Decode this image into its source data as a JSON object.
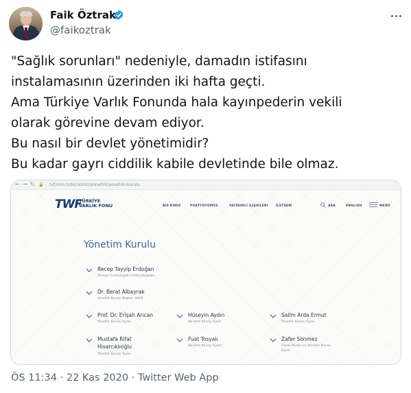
{
  "author": {
    "name": "Faik Öztrak",
    "handle": "@faikoztrak",
    "verified": true
  },
  "tweet": {
    "lines": [
      "\"Sağlık sorunları\" nedeniyle, damadın istifasını",
      "instalamasının üzerinden iki hafta geçti.",
      "Ama Türkiye Varlık Fonunda hala kayınpederin vekili",
      "olarak görevine devam ediyor.",
      "Bu nasıl bir devlet yönetimidir?",
      "Bu kadar gayrı ciddilik kabile devletinde bile olmaz."
    ]
  },
  "attached_screenshot": {
    "url": "tvf.com.tr/biz-kimiz/yonetim/yonetim-kurulu",
    "site": {
      "logo_mark": "TWF",
      "logo_text_line1": "TÜRKİYE",
      "logo_text_line2": "VARLIK FONU",
      "menu": [
        "BİZ KİMİZ",
        "PORTFÖYÜMÜZ",
        "YATIRIMCI İLİŞKİLERİ",
        "İLETİŞİM"
      ],
      "search_label": "ARA",
      "language_label": "ENGLISH",
      "menu_label": "MENÜ",
      "section_title": "Yönetim Kurulu",
      "members": [
        {
          "name": "Recep Tayyip Erdoğan",
          "role": "Türkiye Cumhuriyeti Cumhurbaşkanı"
        },
        {
          "name": "Dr. Berat Albayrak",
          "role": "Yönetim Kurulu Başkan Vekili"
        },
        {
          "name": "Prof. Dr. Erişah Arıcan",
          "role": "Yönetim Kurulu Üyesi"
        },
        {
          "name": "Hüseyin Aydın",
          "role": "Yönetim Kurulu Üyesi"
        },
        {
          "name": "Salim Arda Ermut",
          "role": "Yönetim Kurulu Üyesi"
        },
        {
          "name_line1": "Mustafa Rifat",
          "name_line2": "Hisarcıklıoğlu",
          "role": "Yönetim Kurulu Üyesi"
        },
        {
          "name": "Fuat Tosyalı",
          "role": "Yönetim Kurulu Üyesi"
        },
        {
          "name": "Zafer Sönmez",
          "role_line1": "Genel Müdür ve Yönetim Kurulu",
          "role_line2": "Üyesi"
        }
      ]
    }
  },
  "meta": {
    "time": "ÖS 11:34",
    "date": "22 Kas 2020",
    "source": "Twitter Web App",
    "separator": "·"
  },
  "colors": {
    "verified_badge": "#1d9bf0",
    "tvf_blue": "#3a66a8"
  }
}
